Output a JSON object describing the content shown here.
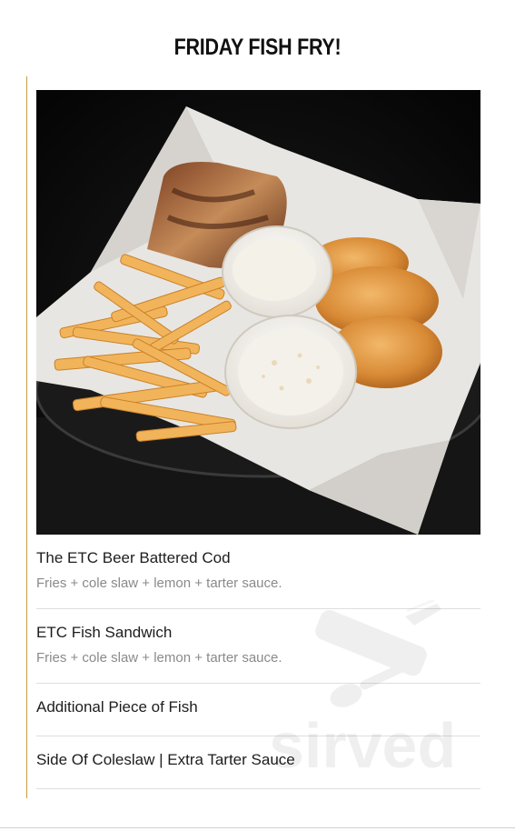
{
  "menu_section": {
    "title": "FRIDAY FISH FRY!",
    "photo_icon": "fish-and-chips-basket-photo",
    "items": [
      {
        "name": "The ETC Beer Battered Cod",
        "description": "Fries + cole slaw + lemon + tarter sauce."
      },
      {
        "name": "ETC Fish Sandwich",
        "description": "Fries + cole slaw + lemon + tarter sauce."
      },
      {
        "name": "Additional Piece of Fish"
      },
      {
        "name": "Side Of Coleslaw | Extra Tarter Sauce"
      }
    ]
  },
  "watermark": {
    "text": "sirved",
    "icon": "knife-fork-spoon-icon"
  },
  "colors": {
    "accent_line": "#c79a3e",
    "title": "#111111",
    "item_name": "#1d1d1d",
    "item_description": "#8a8a8a",
    "divider": "#dedede"
  }
}
